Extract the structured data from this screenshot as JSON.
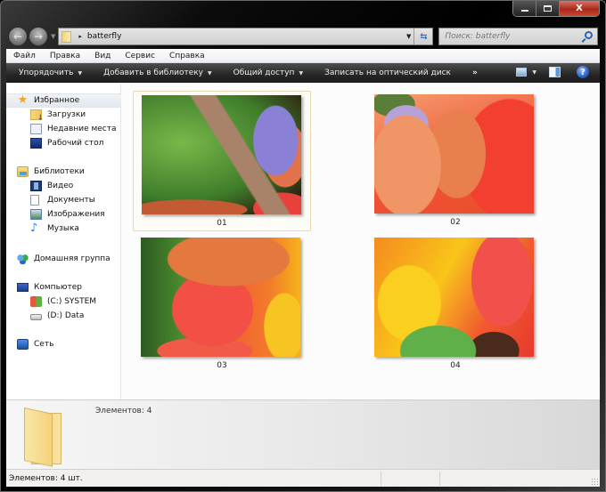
{
  "window": {
    "caption_buttons": {
      "minimize": "minimize",
      "maximize": "maximize",
      "close": "X"
    }
  },
  "nav": {
    "back_icon": "back-arrow-icon",
    "forward_icon": "forward-arrow-icon",
    "address": {
      "path_segment": "batterfly",
      "separator": "▸"
    },
    "search": {
      "placeholder": "Поиск: batterfly"
    }
  },
  "menubar": {
    "items": [
      {
        "label": "Файл"
      },
      {
        "label": "Правка"
      },
      {
        "label": "Вид"
      },
      {
        "label": "Сервис"
      },
      {
        "label": "Справка"
      }
    ]
  },
  "toolbar": {
    "organize": "Упорядочить",
    "add_to_library": "Добавить в библиотеку",
    "share": "Общий доступ",
    "burn": "Записать на оптический диск",
    "more": "»",
    "help": "?"
  },
  "navpane": {
    "favorites": {
      "label": "Избранное",
      "items": [
        {
          "label": "Загрузки"
        },
        {
          "label": "Недавние места"
        },
        {
          "label": "Рабочий стол"
        }
      ]
    },
    "libraries": {
      "label": "Библиотеки",
      "items": [
        {
          "label": "Видео"
        },
        {
          "label": "Документы"
        },
        {
          "label": "Изображения"
        },
        {
          "label": "Музыка"
        }
      ]
    },
    "homegroup": {
      "label": "Домашняя группа"
    },
    "computer": {
      "label": "Компьютер",
      "items": [
        {
          "label": "(C:) SYSTEM"
        },
        {
          "label": "(D:) Data"
        }
      ]
    },
    "network": {
      "label": "Сеть"
    }
  },
  "content": {
    "files": [
      {
        "name": "01",
        "selected": true
      },
      {
        "name": "02",
        "selected": false
      },
      {
        "name": "03",
        "selected": false
      },
      {
        "name": "04",
        "selected": false
      }
    ]
  },
  "details": {
    "text": "Элементов: 4"
  },
  "statusbar": {
    "text": "Элементов: 4 шт."
  }
}
